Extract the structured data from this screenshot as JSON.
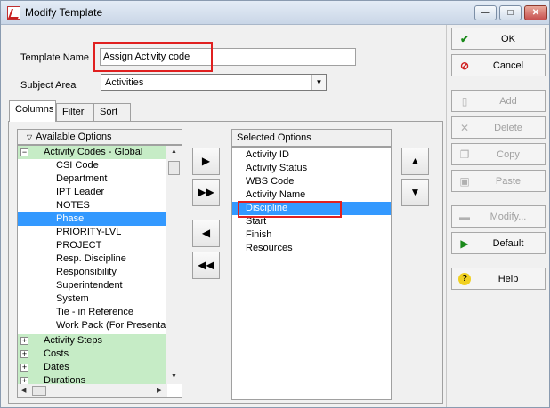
{
  "window": {
    "title": "Modify Template"
  },
  "form": {
    "template_name_label": "Template Name",
    "template_name_value": "Assign Activity code",
    "subject_area_label": "Subject Area",
    "subject_area_value": "Activities"
  },
  "tabs": [
    "Columns",
    "Filter",
    "Sort"
  ],
  "available": {
    "header": "Available Options",
    "rows": [
      {
        "label": "Activity Codes - Global",
        "type": "group",
        "expander": "−"
      },
      {
        "label": "CSI Code"
      },
      {
        "label": "Department"
      },
      {
        "label": "IPT Leader"
      },
      {
        "label": "NOTES"
      },
      {
        "label": "Phase",
        "selected": true
      },
      {
        "label": "PRIORITY-LVL"
      },
      {
        "label": "PROJECT"
      },
      {
        "label": "Resp. Discipline"
      },
      {
        "label": "Responsibility"
      },
      {
        "label": "Superintendent"
      },
      {
        "label": "System"
      },
      {
        "label": "Tie - in Reference"
      },
      {
        "label": "Work Pack (For Presentati"
      },
      {
        "label": "Activity Steps",
        "type": "group",
        "expander": "+"
      },
      {
        "label": "Costs",
        "type": "group",
        "expander": "+"
      },
      {
        "label": "Dates",
        "type": "group",
        "expander": "+"
      },
      {
        "label": "Durations",
        "type": "group",
        "expander": "+"
      }
    ]
  },
  "selected": {
    "header": "Selected Options",
    "rows": [
      {
        "label": "Activity ID"
      },
      {
        "label": "Activity Status"
      },
      {
        "label": "WBS Code"
      },
      {
        "label": "Activity Name"
      },
      {
        "label": "Discipline",
        "selected": true
      },
      {
        "label": "Start"
      },
      {
        "label": "Finish"
      },
      {
        "label": "Resources"
      }
    ]
  },
  "buttons": {
    "ok": "OK",
    "cancel": "Cancel",
    "add": "Add",
    "delete": "Delete",
    "copy": "Copy",
    "paste": "Paste",
    "modify": "Modify...",
    "default": "Default",
    "help": "Help"
  },
  "colors": {
    "selection": "#3399ff",
    "group_row": "#c6ecc6",
    "highlight": "#e02020"
  }
}
